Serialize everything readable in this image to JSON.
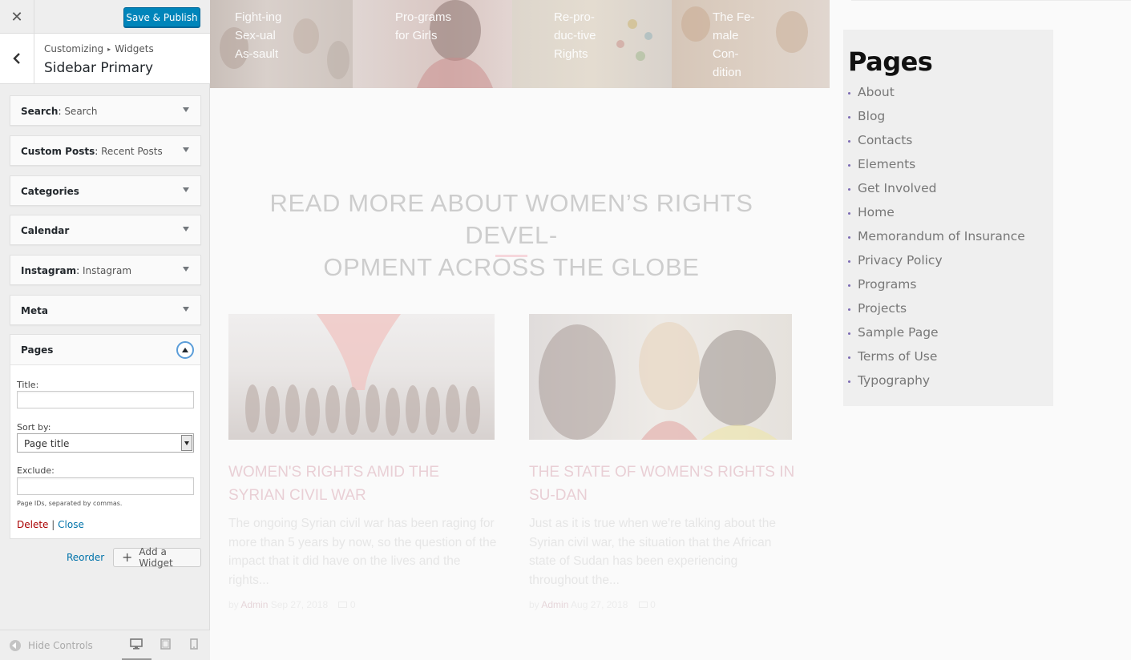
{
  "customizer": {
    "close_label": "✕",
    "publish_label": "Save & Publish",
    "breadcrumb": {
      "part1": "Customizing",
      "separator": "▸",
      "part2": "Widgets"
    },
    "section_title": "Sidebar Primary",
    "widgets": [
      {
        "type": "Search",
        "subtitle": "Search"
      },
      {
        "type": "Custom Posts",
        "subtitle": "Recent Posts"
      },
      {
        "type": "Categories",
        "subtitle": ""
      },
      {
        "type": "Calendar",
        "subtitle": ""
      },
      {
        "type": "Instagram",
        "subtitle": "Instagram"
      },
      {
        "type": "Meta",
        "subtitle": ""
      }
    ],
    "open_widget": {
      "type": "Pages",
      "title_label": "Title:",
      "title_value": "",
      "sort_label": "Sort by:",
      "sort_value": "Page title",
      "exclude_label": "Exclude:",
      "exclude_value": "",
      "help": "Page IDs, separated by commas.",
      "delete_label": "Delete",
      "divider": "|",
      "close_label": "Close"
    },
    "reorder_label": "Reorder",
    "add_widget_label": "Add a Widget",
    "hide_controls_label": "Hide Controls",
    "active_device": "desktop"
  },
  "preview": {
    "tiles": [
      {
        "title": "Fight-ing Sex-ual As-sault"
      },
      {
        "title": "Pro-grams for Girls"
      },
      {
        "title": "Re-pro-duc-tive Rights"
      },
      {
        "title": "The Fe-male Con-dition"
      }
    ],
    "headline_line1": "READ MORE ABOUT WOMEN’S RIGHTS DEVEL-",
    "headline_line2": "OPMENT ACROSS THE GLOBE",
    "posts": [
      {
        "title": "WOMEN'S RIGHTS AMID THE SYRIAN CIVIL WAR",
        "excerpt": "The ongoing Syrian civil war has been raging for more than 5 years by now, so the question of the impact that it did have on the lives and the rights...",
        "by": "by",
        "author": "Admin",
        "date": "Sep 27, 2018",
        "comments": "0"
      },
      {
        "title": "THE STATE OF WOMEN'S RIGHTS IN SU-DAN",
        "excerpt": "Just as it is true when we're talking about the Syrian civil war, the situation that the African state of Sudan has been experiencing throughout the...",
        "by": "by",
        "author": "Admin",
        "date": "Aug 27, 2018",
        "comments": "0"
      }
    ],
    "sidebar": {
      "title": "Pages",
      "pages": [
        "About",
        "Blog",
        "Contacts",
        "Elements",
        "Get Involved",
        "Home",
        "Memorandum of Insurance",
        "Privacy Policy",
        "Programs",
        "Projects",
        "Sample Page",
        "Terms of Use",
        "Typography"
      ]
    }
  },
  "colors": {
    "publish_blue": "#0085ba",
    "link_blue": "#0073aa",
    "delete_red": "#a00",
    "bullet_purple": "#7d6db4",
    "accent_pink": "#f6d7dc"
  }
}
